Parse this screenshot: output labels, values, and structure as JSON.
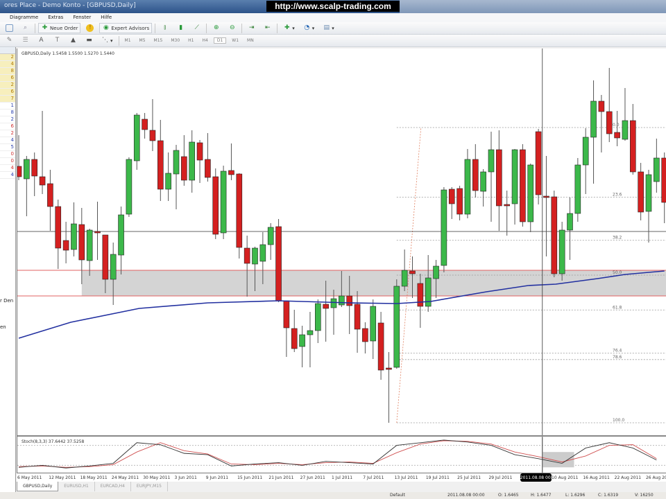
{
  "window": {
    "title": "ores Place - Demo Konto - [GBPUSD,Daily]",
    "watermark": "http://www.scalp-trading.com"
  },
  "menu": [
    "Diagramme",
    "Extras",
    "Fenster",
    "Hilfe"
  ],
  "toolbar": {
    "new_order": "Neue Order",
    "expert_advisors": "Expert Advisors"
  },
  "timeframes": [
    "M1",
    "M5",
    "M15",
    "M30",
    "H1",
    "H4",
    "D1",
    "W1",
    "MN"
  ],
  "active_timeframe": "D1",
  "left_panel": {
    "values": [
      "2",
      "4",
      "8",
      "6",
      "2",
      "6",
      "7",
      "1",
      "8",
      "2",
      "6",
      "2",
      "4",
      "5",
      "0",
      "0",
      "4",
      "4"
    ],
    "text1": "r Den",
    "text2": "en"
  },
  "chart_info": "GBPUSD,Daily  1.5458 1.5500 1.5270 1.5440",
  "stoch_info": "Stoch(8,3,3) 37.6442 37.5258",
  "x_labels": [
    "6 May 2011",
    "12 May 2011",
    "18 May 2011",
    "24 May 2011",
    "30 May 2011",
    "3 Jun 2011",
    "9 Jun 2011",
    "15 Jun 2011",
    "21 Jun 2011",
    "27 Jun 2011",
    "1 Jul 2011",
    "7 Jul 2011",
    "13 Jul 2011",
    "19 Jul 2011",
    "25 Jul 2011",
    "29 Jul 2011",
    "2011.08.08 00:00",
    "10 Aug 2011",
    "16 Aug 2011",
    "22 Aug 2011",
    "26 Aug 2011"
  ],
  "crosshair_label_index": 16,
  "tabs": [
    "GBPUSD,Daily",
    "EURUSD,H1",
    "EURCAD,H4",
    "EURJPY,M15"
  ],
  "status": {
    "profile": "Default",
    "time": "2011.08.08 00:00",
    "open": "O: 1.6465",
    "high": "H: 1.6477",
    "low": "L: 1.6296",
    "close": "C: 1.6319",
    "volume": "V: 16250"
  },
  "colors": {
    "bull": "#3cb84a",
    "bear": "#d42020",
    "ma": "#2230a0",
    "stoch_main": "#333333",
    "stoch_signal": "#d05050",
    "zone": "#d4d4d4",
    "zone_line": "#e06060"
  },
  "chart_data": {
    "type": "candlestick",
    "symbol": "GBPUSD",
    "timeframe": "Daily",
    "price_range": [
      1.603,
      1.67
    ],
    "candles_ohlc": [
      [
        1.646,
        1.6505,
        1.644,
        1.6445
      ],
      [
        1.6442,
        1.6475,
        1.6388,
        1.647
      ],
      [
        1.647,
        1.648,
        1.6417,
        1.6446
      ],
      [
        1.6445,
        1.654,
        1.642,
        1.6433
      ],
      [
        1.6435,
        1.6455,
        1.6367,
        1.6402
      ],
      [
        1.6402,
        1.6412,
        1.6312,
        1.6342
      ],
      [
        1.6353,
        1.638,
        1.632,
        1.6339
      ],
      [
        1.634,
        1.6408,
        1.633,
        1.6377
      ],
      [
        1.6376,
        1.64,
        1.629,
        1.6325
      ],
      [
        1.6324,
        1.637,
        1.6302,
        1.6368
      ],
      [
        1.6366,
        1.6409,
        1.6325,
        1.6365
      ],
      [
        1.6361,
        1.6361,
        1.6277,
        1.6297
      ],
      [
        1.6297,
        1.635,
        1.626,
        1.6333
      ],
      [
        1.6332,
        1.6402,
        1.6304,
        1.639
      ],
      [
        1.6391,
        1.6473,
        1.6387,
        1.647
      ],
      [
        1.6468,
        1.6537,
        1.6455,
        1.6534
      ],
      [
        1.6528,
        1.6537,
        1.65,
        1.6513
      ],
      [
        1.6512,
        1.6557,
        1.6482,
        1.6497
      ],
      [
        1.6497,
        1.6527,
        1.641,
        1.6427
      ],
      [
        1.6427,
        1.648,
        1.641,
        1.645
      ],
      [
        1.6449,
        1.6491,
        1.6398,
        1.6483
      ],
      [
        1.6474,
        1.6505,
        1.6432,
        1.644
      ],
      [
        1.644,
        1.6512,
        1.6422,
        1.6495
      ],
      [
        1.6494,
        1.6498,
        1.6436,
        1.6469
      ],
      [
        1.647,
        1.6508,
        1.6438,
        1.6444
      ],
      [
        1.6445,
        1.6457,
        1.6355,
        1.6362
      ],
      [
        1.6364,
        1.6461,
        1.6355,
        1.6453
      ],
      [
        1.6454,
        1.6493,
        1.644,
        1.6448
      ],
      [
        1.6449,
        1.645,
        1.6327,
        1.6343
      ],
      [
        1.6342,
        1.636,
        1.6272,
        1.632
      ],
      [
        1.6319,
        1.6344,
        1.628,
        1.6342
      ],
      [
        1.6323,
        1.6365,
        1.629,
        1.6347
      ],
      [
        1.6347,
        1.6378,
        1.6325,
        1.6372
      ],
      [
        1.6373,
        1.6384,
        1.6264,
        1.6266
      ],
      [
        1.6266,
        1.6266,
        1.6185,
        1.6227
      ],
      [
        1.6226,
        1.6253,
        1.6192,
        1.6197
      ],
      [
        1.62,
        1.623,
        1.617,
        1.6217
      ],
      [
        1.6217,
        1.625,
        1.617,
        1.6223
      ],
      [
        1.6223,
        1.6268,
        1.6205,
        1.6262
      ],
      [
        1.6261,
        1.6295,
        1.6207,
        1.6255
      ],
      [
        1.6256,
        1.6282,
        1.6217,
        1.6269
      ],
      [
        1.626,
        1.6309,
        1.6257,
        1.6273
      ],
      [
        1.6273,
        1.6302,
        1.6218,
        1.6259
      ],
      [
        1.6261,
        1.628,
        1.6191,
        1.6225
      ],
      [
        1.6226,
        1.6235,
        1.619,
        1.6207
      ],
      [
        1.6208,
        1.6268,
        1.6182,
        1.6258
      ],
      [
        1.6234,
        1.625,
        1.6152,
        1.6166
      ],
      [
        1.6169,
        1.6192,
        1.609,
        1.6168
      ],
      [
        1.617,
        1.6297,
        1.6168,
        1.6287
      ],
      [
        1.6287,
        1.634,
        1.628,
        1.631
      ],
      [
        1.6309,
        1.633,
        1.627,
        1.6305
      ],
      [
        1.6291,
        1.6305,
        1.6227,
        1.6258
      ],
      [
        1.6258,
        1.6332,
        1.625,
        1.6299
      ],
      [
        1.6298,
        1.6325,
        1.627,
        1.6316
      ],
      [
        1.6317,
        1.643,
        1.6307,
        1.6426
      ],
      [
        1.6427,
        1.643,
        1.6384,
        1.6406
      ],
      [
        1.6428,
        1.6432,
        1.6382,
        1.6391
      ],
      [
        1.6391,
        1.6485,
        1.6385,
        1.647
      ],
      [
        1.647,
        1.6492,
        1.6415,
        1.6425
      ],
      [
        1.6424,
        1.6456,
        1.6402,
        1.6452
      ],
      [
        1.6452,
        1.651,
        1.638,
        1.6484
      ],
      [
        1.6484,
        1.6512,
        1.6367,
        1.6403
      ],
      [
        1.6405,
        1.6425,
        1.636,
        1.6404
      ],
      [
        1.6406,
        1.6485,
        1.6376,
        1.6484
      ],
      [
        1.6484,
        1.6492,
        1.6373,
        1.638
      ],
      [
        1.638,
        1.6464,
        1.6365,
        1.6462
      ],
      [
        1.651,
        1.6514,
        1.6405,
        1.6419
      ],
      [
        1.6417,
        1.6475,
        1.633,
        1.6416
      ],
      [
        1.6416,
        1.6425,
        1.63,
        1.6305
      ],
      [
        1.6305,
        1.638,
        1.6295,
        1.6368
      ],
      [
        1.6368,
        1.6415,
        1.6325,
        1.6392
      ],
      [
        1.6392,
        1.6472,
        1.638,
        1.6462
      ],
      [
        1.6462,
        1.6515,
        1.642,
        1.6502
      ],
      [
        1.6502,
        1.6584,
        1.6435,
        1.6554
      ],
      [
        1.6554,
        1.6563,
        1.648,
        1.6539
      ],
      [
        1.6539,
        1.6602,
        1.6495,
        1.6507
      ],
      [
        1.6509,
        1.654,
        1.6489,
        1.6501
      ],
      [
        1.6499,
        1.6573,
        1.6497,
        1.6526
      ],
      [
        1.6526,
        1.655,
        1.6448,
        1.6452
      ],
      [
        1.6452,
        1.6465,
        1.6382,
        1.6394
      ],
      [
        1.6395,
        1.6455,
        1.635,
        1.6448
      ],
      [
        1.6438,
        1.65,
        1.6422,
        1.6472
      ],
      [
        1.6472,
        1.648,
        1.6378,
        1.6408
      ]
    ],
    "moving_average": [
      [
        0,
        1.6212
      ],
      [
        6.6,
        1.6235
      ],
      [
        15.3,
        1.6255
      ],
      [
        24,
        1.6263
      ],
      [
        33,
        1.6266
      ],
      [
        42,
        1.6263
      ],
      [
        48,
        1.6262
      ],
      [
        52.3,
        1.6265
      ],
      [
        59.4,
        1.6279
      ],
      [
        64.7,
        1.6288
      ],
      [
        68.2,
        1.629
      ],
      [
        73.5,
        1.6298
      ],
      [
        77,
        1.6304
      ],
      [
        82,
        1.6309
      ]
    ],
    "horizontal_line": 1.6366,
    "support_zone": {
      "from_index": 8,
      "top": 1.631,
      "bottom": 1.6273
    },
    "fibonacci": {
      "start_index": 48,
      "high": 1.6516,
      "low": 1.609,
      "levels": [
        "0.0",
        "23.6",
        "38.2",
        "50.0",
        "61.8",
        "76.4",
        "78.6",
        "100.0"
      ]
    },
    "crosshair_index": 66.5,
    "stochastic": {
      "range": [
        0,
        100
      ],
      "sample_step": 3,
      "main": [
        14,
        20,
        12,
        18,
        26,
        88,
        82,
        56,
        52,
        18,
        24,
        28,
        20,
        32,
        28,
        24,
        80,
        88,
        96,
        90,
        80,
        52,
        40,
        26,
        72,
        88,
        72,
        36
      ],
      "signal": [
        16,
        18,
        14,
        16,
        22,
        60,
        88,
        64,
        54,
        24,
        22,
        26,
        22,
        28,
        30,
        26,
        58,
        84,
        94,
        92,
        84,
        60,
        46,
        30,
        48,
        80,
        82,
        40
      ]
    },
    "highlight_box_index_range": [
      66,
      70
    ]
  }
}
